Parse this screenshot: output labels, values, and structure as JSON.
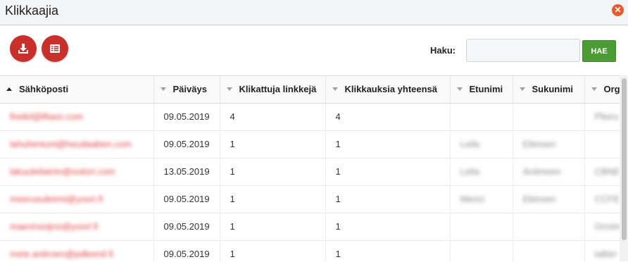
{
  "window": {
    "title": "Klikkaajia",
    "close_icon": "✕"
  },
  "toolbar": {
    "buttons": [
      {
        "icon": "download-icon",
        "color": "#c9302c"
      },
      {
        "icon": "list-icon",
        "color": "#c9302c"
      }
    ],
    "search": {
      "label": "Haku:",
      "value": "",
      "placeholder": "",
      "button_label": "HAE",
      "button_color": "#4a9c33"
    }
  },
  "table": {
    "columns": [
      {
        "label": "Sähköposti",
        "sort": "asc"
      },
      {
        "label": "Päiväys",
        "sort": "none"
      },
      {
        "label": "Klikattuja linkkejä",
        "sort": "none"
      },
      {
        "label": "Klikkauksia yhteensä",
        "sort": "none"
      },
      {
        "label": "Etunimi",
        "sort": "none"
      },
      {
        "label": "Sukunimi",
        "sort": "none"
      },
      {
        "label": "Org",
        "sort": "none"
      }
    ],
    "rows": [
      {
        "email": "lheikil@lfiasn.com",
        "date": "09.05.2019",
        "links": "4",
        "clicks": "4",
        "first": "",
        "last": "",
        "org": "Pfeiro"
      },
      {
        "email": "lahuhimiunt@heudaaben.com",
        "date": "09.05.2019",
        "links": "1",
        "clicks": "1",
        "first": "Leila",
        "last": "Ebinsen",
        "org": ""
      },
      {
        "email": "lakuuleilainin@soitzri.com",
        "date": "13.05.2019",
        "links": "1",
        "clicks": "1",
        "first": "Leila",
        "last": "Aniimeen",
        "org": "CBNE"
      },
      {
        "email": "meerusuleinni@yoori.fi",
        "date": "09.05.2019",
        "links": "1",
        "clicks": "1",
        "first": "Merici",
        "last": "Ebinsen",
        "org": "CCFE"
      },
      {
        "email": "maerinsoijno@yoorl.fi",
        "date": "09.05.2019",
        "links": "1",
        "clicks": "1",
        "first": "",
        "last": "",
        "org": "Ocnim"
      },
      {
        "email": "meie.antiroen@pdleenil.fi",
        "date": "09.05.2019",
        "links": "1",
        "clicks": "1",
        "first": "",
        "last": "",
        "org": "Ialbin"
      }
    ]
  }
}
